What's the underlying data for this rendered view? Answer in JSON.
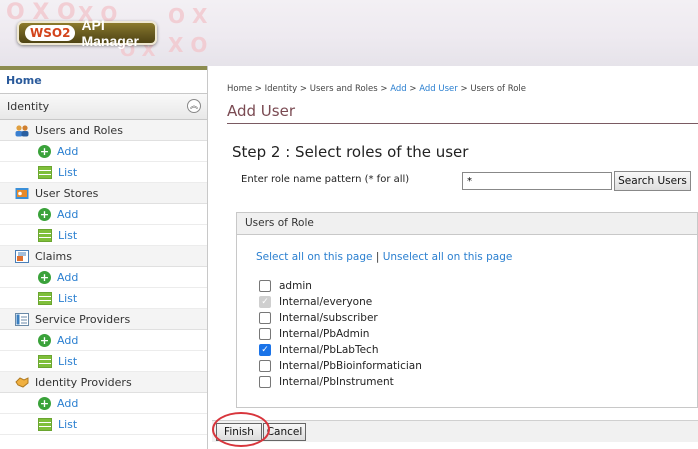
{
  "header": {
    "logo_wso2": "WSO2",
    "logo_product": "API Manager"
  },
  "sidebar": {
    "home": "Home",
    "identity": "Identity",
    "sections": [
      {
        "label": "Users and Roles",
        "icon": "users-roles-icon",
        "items": [
          {
            "label": "Add"
          },
          {
            "label": "List"
          }
        ]
      },
      {
        "label": "User Stores",
        "icon": "user-store-icon",
        "items": [
          {
            "label": "Add"
          },
          {
            "label": "List"
          }
        ]
      },
      {
        "label": "Claims",
        "icon": "claims-icon",
        "items": [
          {
            "label": "Add"
          },
          {
            "label": "List"
          }
        ]
      },
      {
        "label": "Service Providers",
        "icon": "service-provider-icon",
        "items": [
          {
            "label": "Add"
          },
          {
            "label": "List"
          }
        ]
      },
      {
        "label": "Identity Providers",
        "icon": "identity-provider-icon",
        "items": [
          {
            "label": "Add"
          },
          {
            "label": "List"
          }
        ]
      }
    ]
  },
  "breadcrumb": {
    "home": "Home",
    "sep": " > ",
    "identity": "Identity",
    "users_roles": "Users and Roles",
    "add": "Add",
    "add_user": "Add User",
    "current": "Users of Role"
  },
  "main": {
    "title": "Add User",
    "step_title": "Step 2 : Select roles of the user",
    "pattern_label": "Enter role name pattern (* for all)",
    "pattern_value": "*",
    "search_button": "Search Users",
    "box_header": "Users of Role",
    "select_all": "Select all on this page",
    "link_sep": " | ",
    "unselect_all": "Unselect all on this page",
    "roles": [
      {
        "name": "admin",
        "state": "unchecked"
      },
      {
        "name": "Internal/everyone",
        "state": "disabled-checked"
      },
      {
        "name": "Internal/subscriber",
        "state": "unchecked"
      },
      {
        "name": "Internal/PbAdmin",
        "state": "unchecked"
      },
      {
        "name": "Internal/PbLabTech",
        "state": "checked"
      },
      {
        "name": "Internal/PbBioinformatician",
        "state": "unchecked"
      },
      {
        "name": "Internal/PbInstrument",
        "state": "unchecked"
      }
    ],
    "finish_button": "Finish",
    "cancel_button": "Cancel"
  },
  "colors": {
    "accent": "#2a7fd0",
    "title": "#7a4a52",
    "highlight": "#d8353c",
    "checked": "#1a73e8"
  }
}
